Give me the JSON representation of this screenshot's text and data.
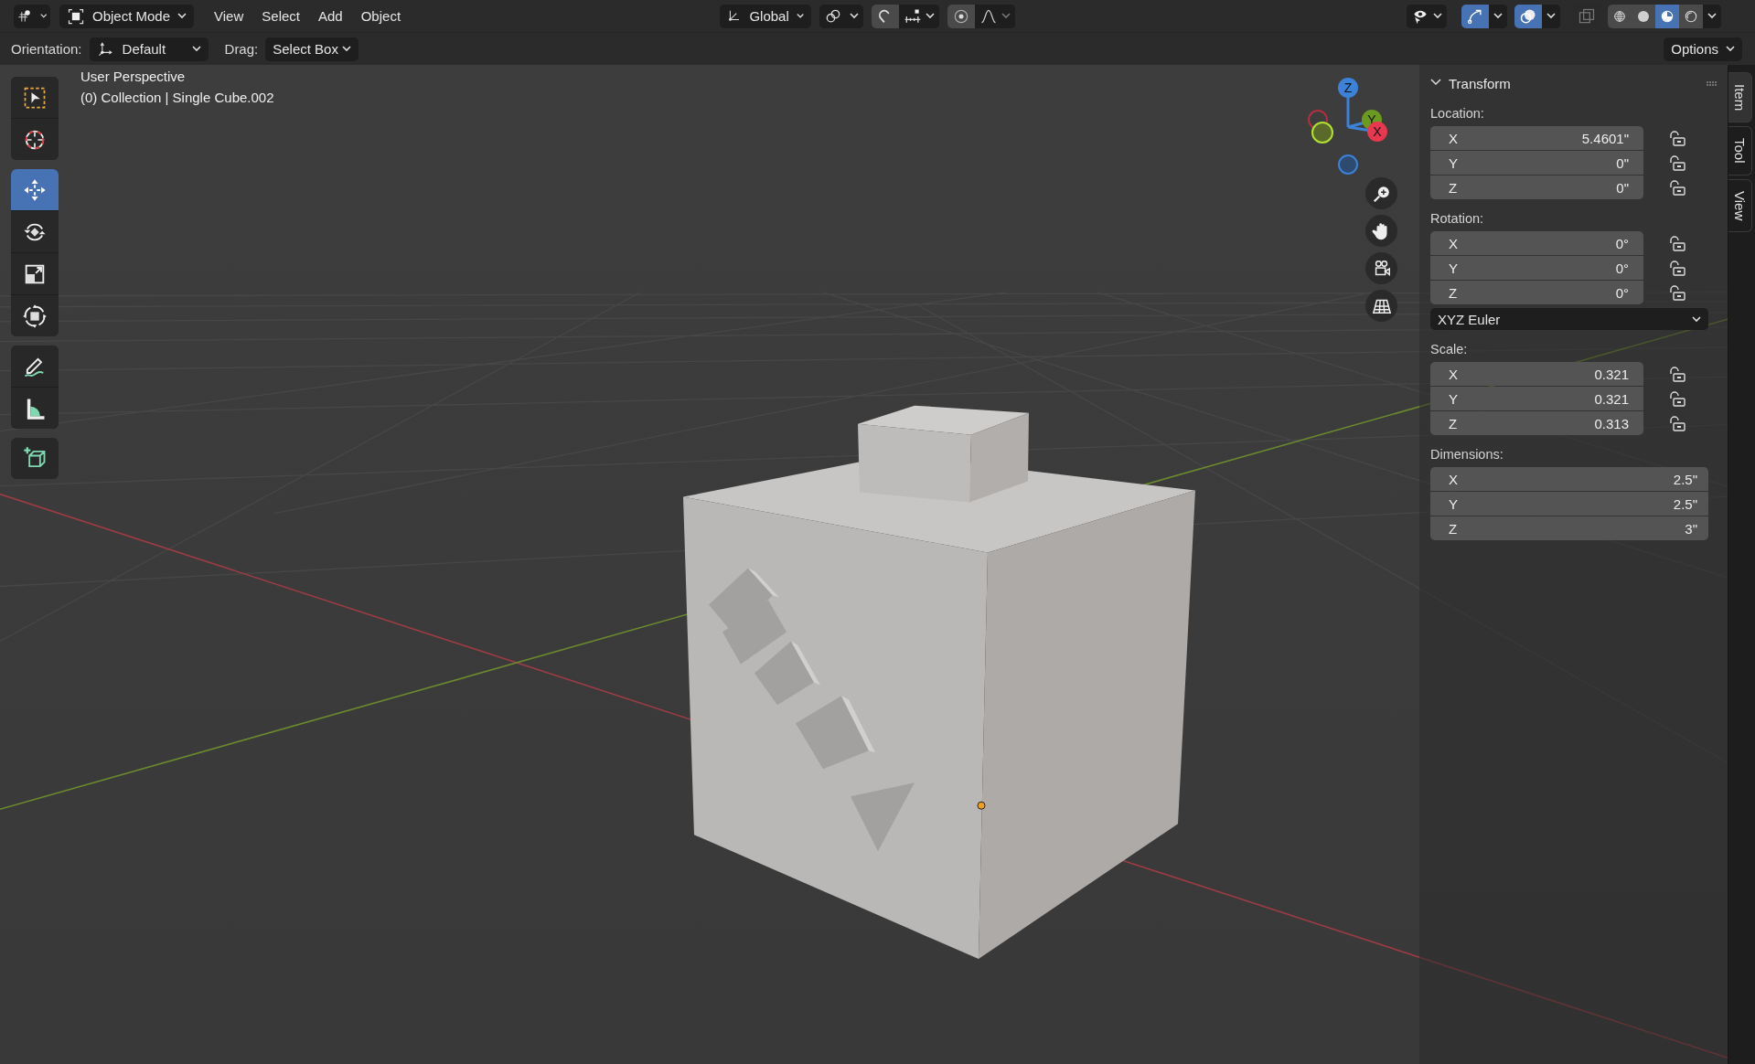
{
  "header": {
    "mode": "Object Mode",
    "menus": [
      "View",
      "Select",
      "Add",
      "Object"
    ],
    "transform_orientation": "Global",
    "snap": {
      "on": false
    },
    "proportional_editing": {
      "on": false
    },
    "show_gizmo": {
      "on": true
    },
    "show_overlays": {
      "on": true
    },
    "xray": {
      "on": false
    },
    "shading_modes": [
      {
        "kind": "wireframe",
        "selected": false
      },
      {
        "kind": "solid",
        "selected": false
      },
      {
        "kind": "material",
        "selected": true
      },
      {
        "kind": "rendered",
        "selected": false
      }
    ]
  },
  "tool_settings": {
    "orientation_label": "Orientation:",
    "orientation": "Default",
    "drag_label": "Drag:",
    "drag": "Select Box",
    "options": "Options"
  },
  "toolbar": [
    {
      "kind": "select_box",
      "selected": false
    },
    {
      "kind": "cursor",
      "selected": false
    },
    {
      "kind": "move",
      "selected": true
    },
    {
      "kind": "rotate",
      "selected": false
    },
    {
      "kind": "scale",
      "selected": false
    },
    {
      "kind": "transform",
      "selected": false
    },
    {
      "kind": "annotate",
      "selected": false
    },
    {
      "kind": "measure",
      "selected": false
    },
    {
      "kind": "add_cube",
      "selected": false
    }
  ],
  "viewport": {
    "view_name": "User Perspective",
    "object_info": "(0) Collection | Single Cube.002"
  },
  "navigation_gizmo": {
    "axes": [
      "Z",
      "Y",
      "X"
    ]
  },
  "sidebar": {
    "panel": {
      "title": "Transform",
      "expanded": true,
      "location": {
        "label": "Location:",
        "rows": [
          {
            "axis": "X",
            "value": "5.4601\"",
            "locked": false
          },
          {
            "axis": "Y",
            "value": "0\"",
            "locked": false
          },
          {
            "axis": "Z",
            "value": "0\"",
            "locked": false
          }
        ]
      },
      "rotation": {
        "label": "Rotation:",
        "rows": [
          {
            "axis": "X",
            "value": "0°",
            "locked": false
          },
          {
            "axis": "Y",
            "value": "0°",
            "locked": false
          },
          {
            "axis": "Z",
            "value": "0°",
            "locked": false
          }
        ]
      },
      "rotation_mode": "XYZ Euler",
      "scale": {
        "label": "Scale:",
        "rows": [
          {
            "axis": "X",
            "value": "0.321",
            "locked": false
          },
          {
            "axis": "Y",
            "value": "0.321",
            "locked": false
          },
          {
            "axis": "Z",
            "value": "0.313",
            "locked": false
          }
        ]
      },
      "dimensions": {
        "label": "Dimensions:",
        "rows": [
          {
            "axis": "X",
            "value": "2.5\""
          },
          {
            "axis": "Y",
            "value": "2.5\""
          },
          {
            "axis": "Z",
            "value": "3\""
          }
        ]
      }
    },
    "tabs": [
      {
        "label": "Item",
        "selected": true
      },
      {
        "label": "Tool",
        "selected": false
      },
      {
        "label": "View",
        "selected": false
      }
    ]
  }
}
